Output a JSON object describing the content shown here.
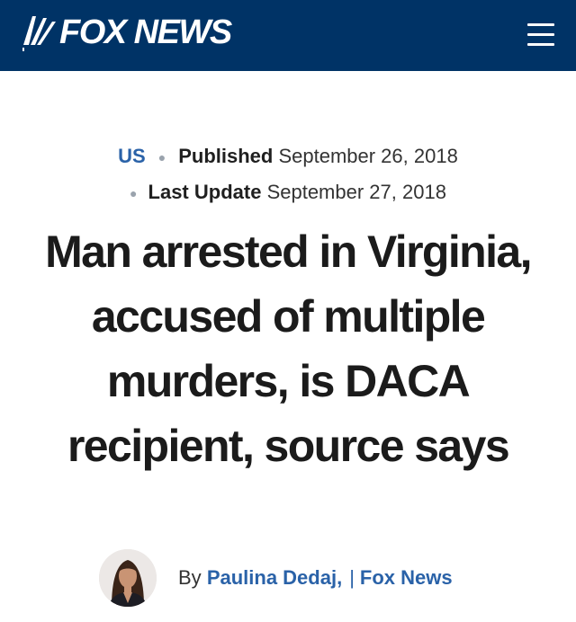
{
  "header": {
    "logo_text": "FOX NEWS",
    "menu_icon": "hamburger-menu-icon",
    "background_color": "#003366"
  },
  "article": {
    "category": "US",
    "published_label": "Published",
    "published_date": "September 26, 2018",
    "updated_label": "Last Update",
    "updated_date": "September 27, 2018",
    "headline": "Man arrested in Virginia, accused of multiple murders, is DACA recipient, source says",
    "byline_prefix": "By",
    "author": "Paulina Dedaj,",
    "separator": "|",
    "source": "Fox News"
  },
  "colors": {
    "link": "#2a62a8",
    "headline": "#1b1b1b",
    "dot": "#9aa3ad"
  }
}
